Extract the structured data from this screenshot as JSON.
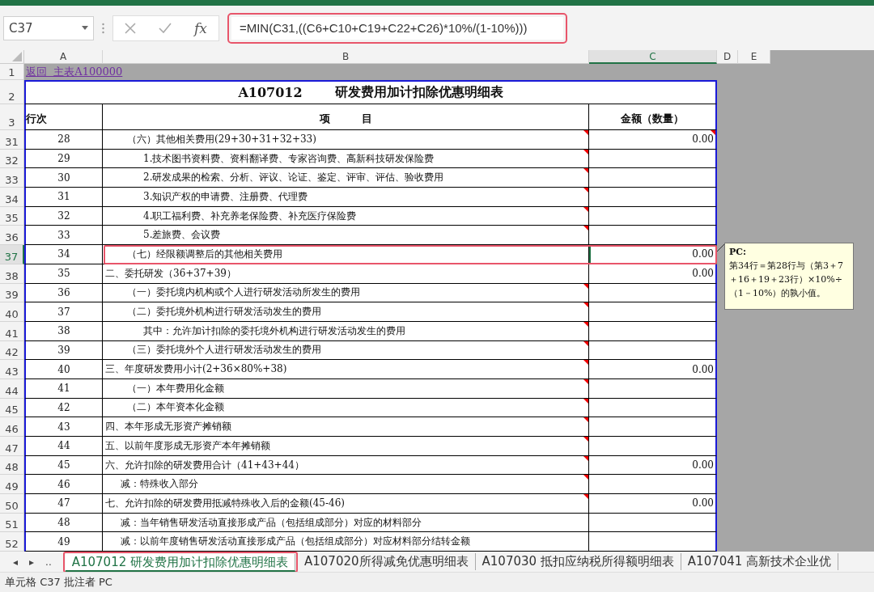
{
  "name_box": {
    "value": "C37"
  },
  "formula_bar": {
    "fx": "fx",
    "formula": "=MIN(C31,((C6+C10+C19+C22+C26)*10%/(1-10%)))",
    "highlighted": true
  },
  "columns": [
    {
      "label": "A",
      "selected": false
    },
    {
      "label": "B",
      "selected": false
    },
    {
      "label": "C",
      "selected": true
    },
    {
      "label": "D",
      "selected": false
    },
    {
      "label": "E",
      "selected": false
    }
  ],
  "link_row": {
    "row": "1",
    "link": "返回  主表A100000"
  },
  "title_row": {
    "row": "2",
    "code": "A107012",
    "title": "研发费用加计扣除优惠明细表"
  },
  "header_row": {
    "row": "3",
    "col_a": "行次",
    "col_b": "项　　　目",
    "col_c": "金额（数量）"
  },
  "rows": [
    {
      "row": "31",
      "line": "28",
      "item": "（六）其他相关费用(29+30+31+32+33)",
      "amount": "0.00",
      "kind": "sub",
      "selected": false,
      "highlighted": false,
      "comment_mark": true,
      "amount_mark": true
    },
    {
      "row": "32",
      "line": "29",
      "item": "1.技术图书资料费、资料翻译费、专家咨询费、高新科技研发保险费",
      "kind": "item",
      "selected": false,
      "highlighted": false,
      "comment_mark": true
    },
    {
      "row": "33",
      "line": "30",
      "item": "2.研发成果的检索、分析、评议、论证、鉴定、评审、评估、验收费用",
      "kind": "item",
      "selected": false,
      "highlighted": false,
      "comment_mark": true
    },
    {
      "row": "34",
      "line": "31",
      "item": "3.知识产权的申请费、注册费、代理费",
      "kind": "item",
      "selected": false,
      "highlighted": false,
      "comment_mark": true
    },
    {
      "row": "35",
      "line": "32",
      "item": "4.职工福利费、补充养老保险费、补充医疗保险费",
      "kind": "item",
      "selected": false,
      "highlighted": false,
      "comment_mark": true
    },
    {
      "row": "36",
      "line": "33",
      "item": "5.差旅费、会议费",
      "kind": "item",
      "selected": false,
      "highlighted": false,
      "comment_mark": true
    },
    {
      "row": "37",
      "line": "34",
      "item": "（七）经限额调整后的其他相关费用",
      "amount": "0.00",
      "kind": "sub",
      "selected": true,
      "highlighted": true,
      "comment_mark": false
    },
    {
      "row": "38",
      "line": "35",
      "item": "二、委托研发（36+37+39）",
      "amount": "0.00",
      "kind": "section",
      "selected": false,
      "highlighted": false,
      "comment_mark": false
    },
    {
      "row": "39",
      "line": "36",
      "item": "（一）委托境内机构或个人进行研发活动所发生的费用",
      "kind": "sub",
      "selected": false,
      "highlighted": false,
      "comment_mark": true
    },
    {
      "row": "40",
      "line": "37",
      "item": "（二）委托境外机构进行研发活动发生的费用",
      "kind": "sub",
      "selected": false,
      "highlighted": false,
      "comment_mark": true
    },
    {
      "row": "41",
      "line": "38",
      "item": "其中：允许加计扣除的委托境外机构进行研发活动发生的费用",
      "kind": "item",
      "selected": false,
      "highlighted": false,
      "comment_mark": true
    },
    {
      "row": "42",
      "line": "39",
      "item": "（三）委托境外个人进行研发活动发生的费用",
      "kind": "sub",
      "selected": false,
      "highlighted": false,
      "comment_mark": true
    },
    {
      "row": "43",
      "line": "40",
      "item": "三、年度研发费用小计(2+36×80%+38)",
      "amount": "0.00",
      "kind": "section",
      "selected": false,
      "highlighted": false,
      "comment_mark": true
    },
    {
      "row": "44",
      "line": "41",
      "item": "（一）本年费用化金额",
      "kind": "sub",
      "selected": false,
      "highlighted": false,
      "comment_mark": true
    },
    {
      "row": "45",
      "line": "42",
      "item": "（二）本年资本化金额",
      "kind": "sub",
      "selected": false,
      "highlighted": false,
      "comment_mark": true
    },
    {
      "row": "46",
      "line": "43",
      "item": "四、本年形成无形资产摊销额",
      "kind": "section",
      "selected": false,
      "highlighted": false,
      "comment_mark": true
    },
    {
      "row": "47",
      "line": "44",
      "item": "五、以前年度形成无形资产本年摊销额",
      "kind": "section",
      "selected": false,
      "highlighted": false,
      "comment_mark": true
    },
    {
      "row": "48",
      "line": "45",
      "item": "六、允许扣除的研发费用合计（41+43+44）",
      "amount": "0.00",
      "kind": "section",
      "selected": false,
      "highlighted": false,
      "comment_mark": true
    },
    {
      "row": "49",
      "line": "46",
      "item": "减：特殊收入部分",
      "kind": "minus",
      "selected": false,
      "highlighted": false,
      "comment_mark": true
    },
    {
      "row": "50",
      "line": "47",
      "item": "七、允许扣除的研发费用抵减特殊收入后的金额(45-46)",
      "amount": "0.00",
      "kind": "section",
      "selected": false,
      "highlighted": false,
      "comment_mark": true
    },
    {
      "row": "51",
      "line": "48",
      "item": "减：当年销售研发活动直接形成产品（包括组成部分）对应的材料部分",
      "kind": "minus",
      "selected": false,
      "highlighted": false,
      "comment_mark": false
    },
    {
      "row": "52",
      "line": "49",
      "item": "减：以前年度销售研发活动直接形成产品（包括组成部分）对应材料部分结转金额",
      "kind": "minus",
      "selected": false,
      "highlighted": false,
      "comment_mark": false
    }
  ],
  "comment": {
    "author": "PC:",
    "text": "第34行＝第28行与（第3＋7＋16＋19＋23行）×10%÷（1－10%）的孰小值。"
  },
  "tab_nav": [
    "◂",
    "▸",
    ".."
  ],
  "sheet_tabs": [
    {
      "label": "A107012 研发费用加计扣除优惠明细表",
      "selected": true,
      "highlighted": true
    },
    {
      "label": "A107020所得减免优惠明细表",
      "selected": false,
      "highlighted": false
    },
    {
      "label": "A107030 抵扣应纳税所得额明细表",
      "selected": false,
      "highlighted": false
    },
    {
      "label": "A107041 高新技术企业优",
      "selected": false,
      "highlighted": false
    }
  ],
  "status_bar": {
    "text": "单元格 C37 批注者 PC"
  }
}
